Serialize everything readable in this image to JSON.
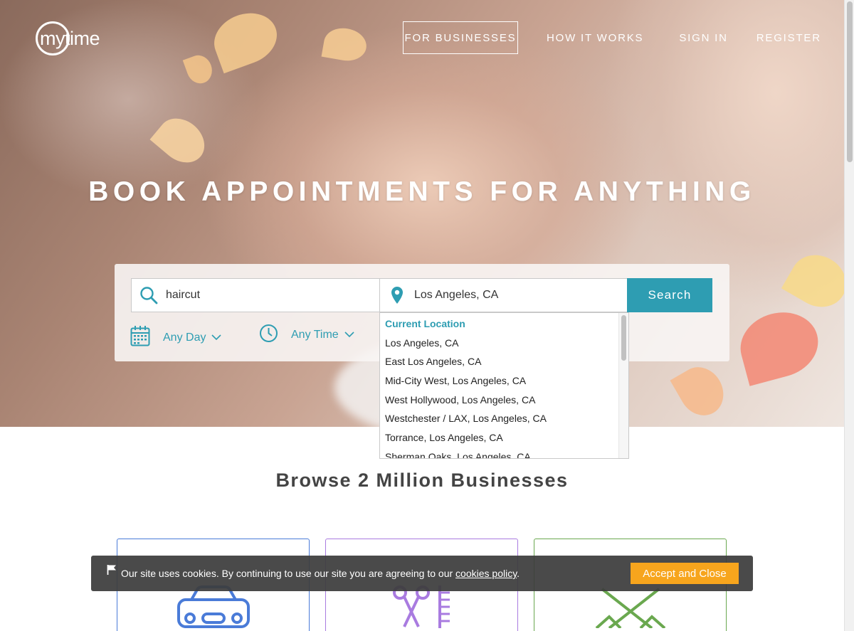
{
  "brand": {
    "logo_text": "mytime"
  },
  "nav": {
    "for_businesses": "FOR BUSINESSES",
    "how_it_works": "HOW IT WORKS",
    "sign_in": "SIGN IN",
    "register": "REGISTER"
  },
  "hero": {
    "title": "BOOK APPOINTMENTS FOR ANYTHING"
  },
  "search": {
    "what_value": "haircut",
    "where_value": "Los Angeles, CA",
    "button_label": "Search",
    "day_filter": "Any Day",
    "time_filter": "Any Time",
    "accent_color": "#2e9db2"
  },
  "location_dropdown": {
    "items": [
      "Current Location",
      "Los Angeles, CA",
      "East Los Angeles, CA",
      "Mid-City West, Los Angeles, CA",
      "West Hollywood, Los Angeles, CA",
      "Westchester / LAX, Los Angeles, CA",
      "Torrance, Los Angeles, CA",
      "Sherman Oaks, Los Angeles, CA"
    ]
  },
  "browse": {
    "title": "Browse 2 Million Businesses",
    "categories": [
      {
        "icon": "car-icon",
        "color": "#4a7bd8"
      },
      {
        "icon": "scissors-comb-icon",
        "color": "#a97be0"
      },
      {
        "icon": "spa-icon",
        "color": "#6aa84f"
      }
    ]
  },
  "cookie_banner": {
    "text": "Our site uses cookies. By continuing to use our site you are agreeing to our",
    "link": "cookies policy",
    "period": ".",
    "button": "Accept and Close",
    "button_color": "#f7a51d"
  }
}
